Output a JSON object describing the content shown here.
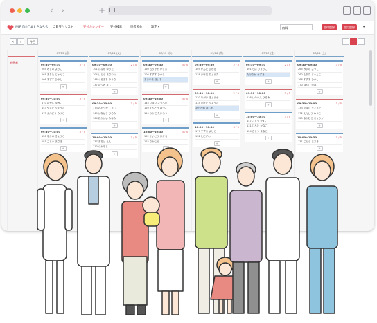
{
  "browser": {
    "back": "‹",
    "forward": "›",
    "new_tab": "+"
  },
  "app": {
    "logo": "MEDICALPASS",
    "menus": [
      "当日受付リスト",
      "受付カレンダー",
      "受付検索",
      "患者照会",
      "設定 ▾"
    ],
    "active_menu_index": 1,
    "select_value": "内科",
    "buttons": [
      "受付登録",
      "受付登録"
    ],
    "user": "▾"
  },
  "toolbar": {
    "prev": "‹",
    "next": "›",
    "today": "今日"
  },
  "calendar": {
    "first_col_label": "新患者",
    "columns": [
      {
        "date": "07/13 (月)",
        "slots": [
          {
            "time": "09:30〜09:30",
            "count": "3 / 5",
            "patients": [
              {
                "name": "265 みずの ようこ"
              },
              {
                "name": "265 ありた じゅんこ"
              },
              {
                "name": "166 すずす ひかし"
              }
            ]
          },
          {
            "time": "09:30〜10:00",
            "count": "3 / 5",
            "patients": [
              {
                "name": "170 はやし ゆみこ"
              },
              {
                "name": "153 やまだ りょうた"
              },
              {
                "name": "175 えんどう みつこ"
              }
            ]
          },
          {
            "time": "09:30〜10:00",
            "count": "3 / 5",
            "patients": [
              {
                "name": "128 なかの きょうこ"
              },
              {
                "name": "181 ごとう まさき"
              }
            ]
          }
        ]
      },
      {
        "date": "07/14 (火)",
        "slots": [
          {
            "time": "09:30〜09:30",
            "count": "2 / 5",
            "patients": [
              {
                "name": "101 たなか ゆうた"
              },
              {
                "name": "104 いとう まさつぐ"
              },
              {
                "name": "146 くろまち ゆうな"
              },
              {
                "name": "137 はつみ よしこ"
              }
            ]
          },
          {
            "time": "09:30〜10:00",
            "count": "3 / 5",
            "patients": [
              {
                "name": "173 おおつか こうじ"
              },
              {
                "name": "149 いなばき ひろみ"
              },
              {
                "name": "164 おかいい みなみ"
              }
            ]
          },
          {
            "time": "10:00〜10:30",
            "count": "3 / 5",
            "patients": [
              {
                "name": "137 まちは えん"
              },
              {
                "name": "110 つかもと"
              }
            ]
          }
        ]
      },
      {
        "date": "07/15 (水)",
        "slots": [
          {
            "time": "09:30〜09:30",
            "count": "3 / 5",
            "patients": [
              {
                "name": "160 もりかわ かずま"
              },
              {
                "name": "106 すずす ひかし"
              },
              {
                "name": "あきやま きいち",
                "hl": true
              }
            ]
          },
          {
            "time": "09:30〜10:00",
            "count": "3 / 5",
            "patients": [
              {
                "name": "145 いまい ようへい"
              },
              {
                "name": "120 えんどう みつこ"
              },
              {
                "name": "120 つかだ たいろう"
              }
            ]
          },
          {
            "time": "10:00〜10:30",
            "count": "3 / 5",
            "patients": [
              {
                "name": "152 かいとう ひかる"
              },
              {
                "name": "125 なかむら"
              }
            ]
          }
        ]
      },
      {
        "date": "07/16 (木)",
        "slots": [
          {
            "time": "09:30〜09:30",
            "count": "2 / 5",
            "patients": [
              {
                "name": "105 かんだ ひかる"
              },
              {
                "name": "138 いけだ りょうた"
              }
            ]
          },
          {
            "time": "09:30〜10:00",
            "count": "2 / 5",
            "patients": [
              {
                "name": "130 ながい きょうか"
              },
              {
                "name": "135 いけだ りょうた"
              },
              {
                "name": "あらかわ はじめ",
                "hl": true
              }
            ]
          },
          {
            "time": "10:00〜10:30",
            "count": "3 / 5",
            "patients": [
              {
                "name": "177 すずき よしこ"
              },
              {
                "name": "132 たにがわ"
              }
            ]
          }
        ]
      },
      {
        "date": "07/17 (金)",
        "slots": [
          {
            "time": "09:30〜09:30",
            "count": "2 / 5",
            "patients": [
              {
                "name": "101 ちば りょうこ"
              },
              {
                "name": "たけなか みずき",
                "hl": true
              }
            ]
          },
          {
            "time": "09:30〜10:00",
            "count": "3 / 5",
            "patients": [
              {
                "name": "116 いのうえ ひろみ"
              }
            ]
          },
          {
            "time": "10:00〜10:30",
            "count": "3 / 5",
            "patients": [
              {
                "name": "147 さとう かずこ"
              },
              {
                "name": "131 ひろた かなこ"
              },
              {
                "name": "124 さとう まなこ"
              }
            ]
          }
        ]
      },
      {
        "date": "07/18 (土)",
        "slots": [
          {
            "time": "09:30〜09:30",
            "count": "3 / 5",
            "patients": [
              {
                "name": "265 みずの ようこ"
              },
              {
                "name": "260 もりた じゅんこ"
              },
              {
                "name": "166 すずす ひかし"
              },
              {
                "name": "170 はやし ゆみこ"
              }
            ]
          },
          {
            "time": "09:30〜10:00",
            "count": "3 / 5",
            "patients": [
              {
                "name": "133 やまだ りょうた"
              },
              {
                "name": "172 えんどう みつこ"
              },
              {
                "name": "125 なかむら きょうか"
              }
            ]
          },
          {
            "time": "10:00〜10:30",
            "count": "3 / 5",
            "patients": [
              {
                "name": "131 ごとう まさき"
              }
            ]
          }
        ]
      }
    ]
  },
  "colors": {
    "accent": "#d9434f",
    "slot_blue": "#6f9fc8",
    "highlight": "#d6e6f7"
  }
}
